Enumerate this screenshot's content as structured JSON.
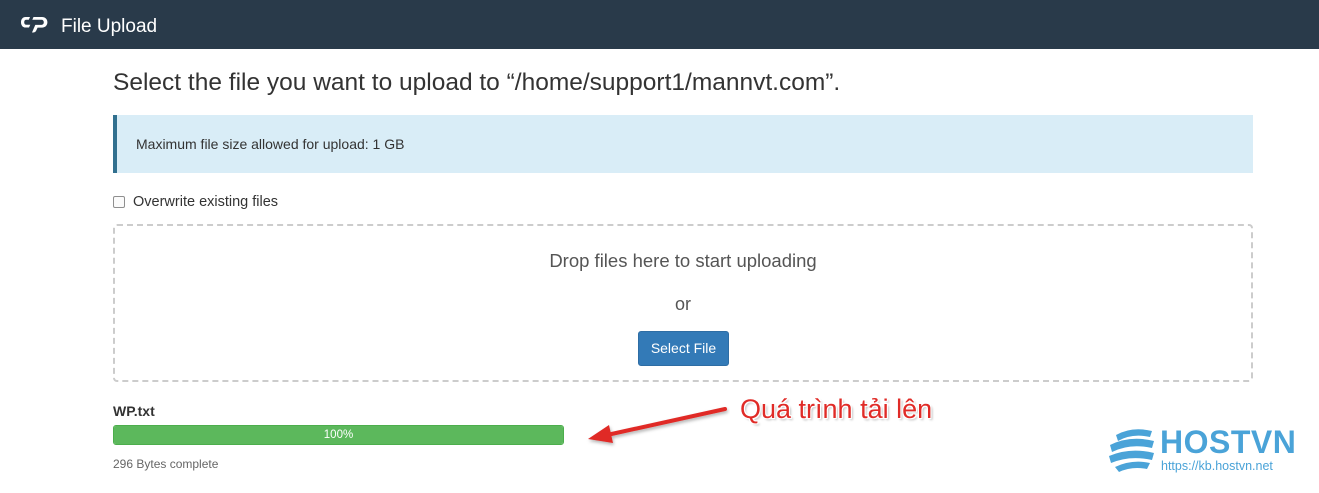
{
  "header": {
    "app_title": "File Upload",
    "logo_icon": "cpanel-logo-icon",
    "background_color": "#293a4a"
  },
  "main": {
    "heading": "Select the file you want to upload to “/home/support1/mannvt.com”.",
    "info_message": "Maximum file size allowed for upload: 1 GB",
    "overwrite_label": "Overwrite existing files",
    "overwrite_checked": false,
    "dropzone": {
      "prompt": "Drop files here to start uploading",
      "or_text": "or",
      "select_button_label": "Select File"
    },
    "upload": {
      "file_name": "WP.txt",
      "progress_label": "100%",
      "progress_fraction": 1.0,
      "status": "296 Bytes complete"
    }
  },
  "annotation": {
    "text": "Quá trình tải lên",
    "color": "#e02b27"
  },
  "watermark": {
    "brand": "HOSTVN",
    "url": "https://kb.hostvn.net",
    "color": "#4aa3d8"
  },
  "colors": {
    "info_background": "#d9edf7",
    "primary_button": "#337ab7",
    "progress_fill": "#5cb85c"
  }
}
